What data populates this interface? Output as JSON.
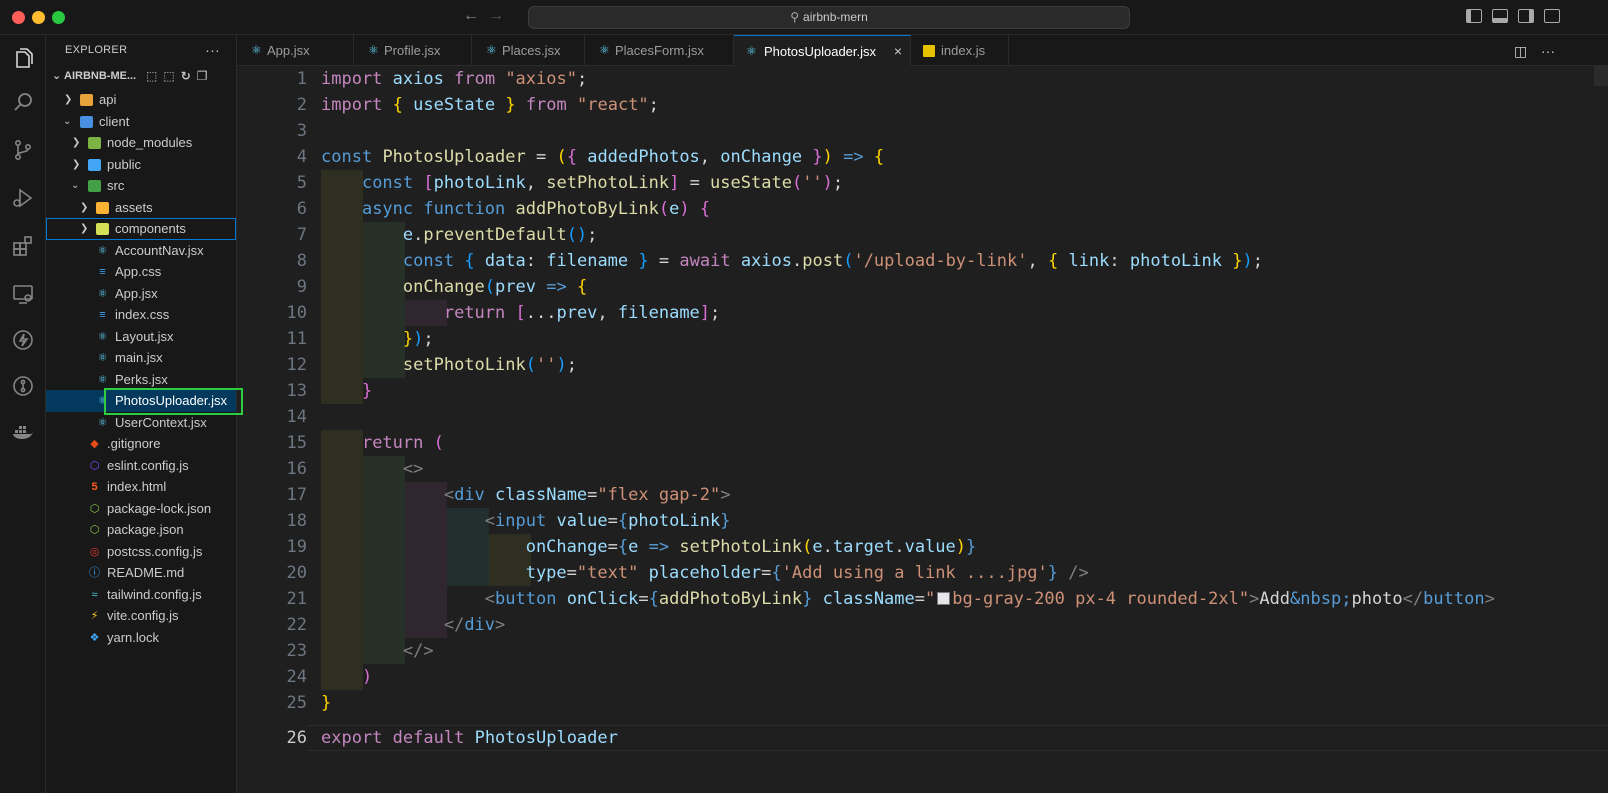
{
  "window": {
    "search_text": "airbnb-mern",
    "accent_color": "#0078d4"
  },
  "activity_bar": {
    "icons": [
      "files-icon",
      "search-icon",
      "source-control-icon",
      "run-debug-icon",
      "extensions-icon",
      "remote-explorer-icon",
      "thunder-client-icon",
      "gitlens-icon",
      "docker-icon"
    ]
  },
  "sidebar": {
    "title": "EXPLORER",
    "more": "···",
    "project": "AIRBNB-ME...",
    "items": [
      {
        "label": "api"
      },
      {
        "label": "client"
      },
      {
        "label": "node_modules"
      },
      {
        "label": "public"
      },
      {
        "label": "src"
      },
      {
        "label": "assets"
      },
      {
        "label": "components"
      },
      {
        "label": "AccountNav.jsx"
      },
      {
        "label": "App.css"
      },
      {
        "label": "App.jsx"
      },
      {
        "label": "index.css"
      },
      {
        "label": "Layout.jsx"
      },
      {
        "label": "main.jsx"
      },
      {
        "label": "Perks.jsx"
      },
      {
        "label": "PhotosUploader.jsx"
      },
      {
        "label": "UserContext.jsx"
      },
      {
        "label": ".gitignore"
      },
      {
        "label": "eslint.config.js"
      },
      {
        "label": "index.html"
      },
      {
        "label": "package-lock.json"
      },
      {
        "label": "package.json"
      },
      {
        "label": "postcss.config.js"
      },
      {
        "label": "README.md"
      },
      {
        "label": "tailwind.config.js"
      },
      {
        "label": "vite.config.js"
      },
      {
        "label": "yarn.lock"
      }
    ]
  },
  "tabs": [
    {
      "label": "App.jsx"
    },
    {
      "label": "Profile.jsx"
    },
    {
      "label": "Places.jsx"
    },
    {
      "label": "PlacesForm.jsx"
    },
    {
      "label": "PhotosUploader.jsx",
      "close": "×"
    },
    {
      "label": "index.js"
    }
  ],
  "editor": {
    "line_numbers": [
      "1",
      "2",
      "3",
      "4",
      "5",
      "6",
      "7",
      "8",
      "9",
      "10",
      "11",
      "12",
      "13",
      "14",
      "15",
      "16",
      "17",
      "18",
      "19",
      "20",
      "21",
      "22",
      "23",
      "24",
      "25",
      "26"
    ],
    "current_line": "26"
  }
}
